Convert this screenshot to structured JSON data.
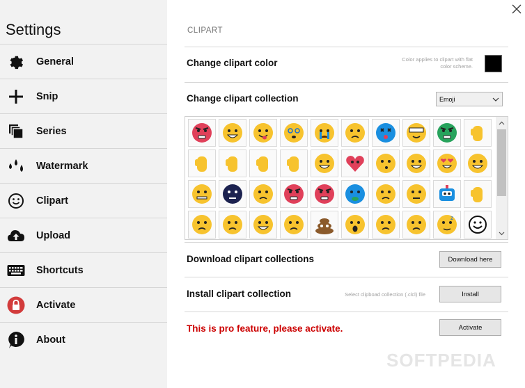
{
  "sidebar": {
    "title": "Settings",
    "items": [
      {
        "label": "General",
        "icon": "gear-icon"
      },
      {
        "label": "Snip",
        "icon": "plus-icon"
      },
      {
        "label": "Series",
        "icon": "series-icon"
      },
      {
        "label": "Watermark",
        "icon": "drops-icon"
      },
      {
        "label": "Clipart",
        "icon": "smiley-icon"
      },
      {
        "label": "Upload",
        "icon": "cloud-upload-icon"
      },
      {
        "label": "Shortcuts",
        "icon": "keyboard-icon"
      },
      {
        "label": "Activate",
        "icon": "lock-icon"
      },
      {
        "label": "About",
        "icon": "info-icon"
      }
    ]
  },
  "main": {
    "section_title": "CLIPART",
    "color_row": {
      "label": "Change clipart color",
      "hint": "Color applies to clipart with flat color scheme.",
      "swatch_color": "#000000"
    },
    "collection_row": {
      "label": "Change clipart collection",
      "selected": "Emoji"
    },
    "download_row": {
      "label": "Download clipart collections",
      "button": "Download here"
    },
    "install_row": {
      "label": "Install clipart collection",
      "hint": "Select clipboad collection (.clcl) file",
      "button": "Install"
    },
    "activate_row": {
      "label": "This is pro feature, please activate.",
      "button": "Activate"
    }
  },
  "watermark": "SOFTPEDIA",
  "colors": {
    "sidebar_bg": "#f2f2f2",
    "pro_text": "#cc0000",
    "emoji_yellow": "#f7c32e"
  }
}
